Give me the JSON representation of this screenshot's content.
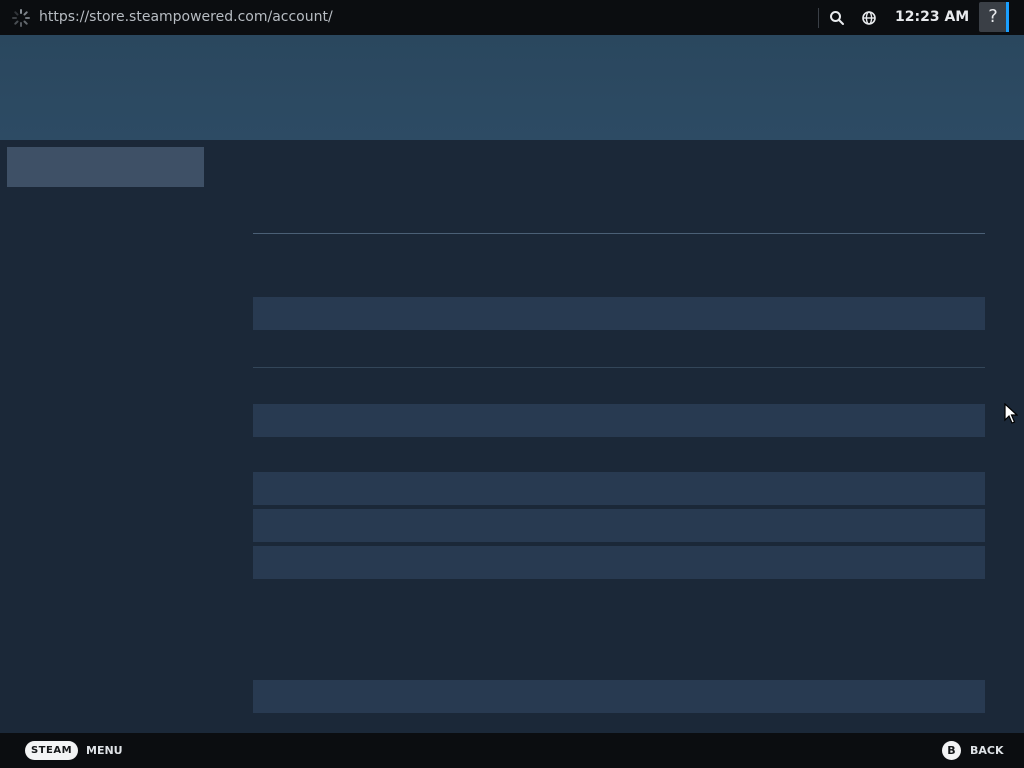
{
  "topbar": {
    "url": "https://store.steampowered.com/account/",
    "time": "12:23 AM",
    "help_label": "?",
    "icons": [
      "loading-spinner-icon",
      "search-icon",
      "globe-icon"
    ]
  },
  "bottombar": {
    "steam_label": "STEAM",
    "menu_label": "MENU",
    "b_label": "B",
    "back_label": "BACK"
  },
  "colors": {
    "accent": "#1a9fff",
    "background": "#1b2838",
    "header": "#2a475e",
    "skeleton": "#283a51"
  }
}
